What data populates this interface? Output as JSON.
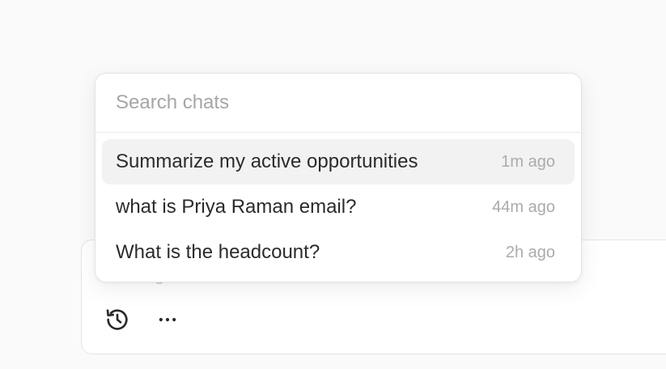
{
  "composer": {
    "placeholder": "Ask Lightfield",
    "history_icon": "history-icon",
    "more_icon": "more-horizontal-icon"
  },
  "chat_search": {
    "placeholder": "Search chats"
  },
  "chats": [
    {
      "title": "Summarize my active opportunities",
      "time": "1m ago",
      "active": true
    },
    {
      "title": "what is Priya Raman email?",
      "time": "44m ago",
      "active": false
    },
    {
      "title": "What is the headcount?",
      "time": "2h ago",
      "active": false
    }
  ],
  "colors": {
    "background": "#fafafa",
    "hover_row": "#f2f2f2",
    "text": "#2b2b2b",
    "muted": "#ababab"
  }
}
